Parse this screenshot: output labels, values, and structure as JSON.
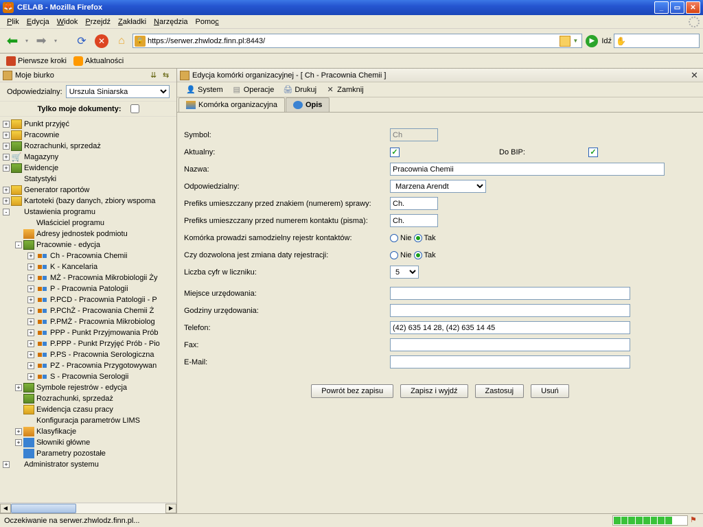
{
  "titlebar": {
    "title": "CELAB - Mozilla Firefox"
  },
  "menubar": [
    "Plik",
    "Edycja",
    "Widok",
    "Przejdź",
    "Zakładki",
    "Narzędzia",
    "Pomoc"
  ],
  "url": "https://serwer.zhwlodz.finn.pl:8443/",
  "go_label": "Idź",
  "bookmarks": [
    {
      "label": "Pierwsze kroki"
    },
    {
      "label": "Aktualności"
    }
  ],
  "left": {
    "title": "Moje biurko",
    "odpowiedzialny_label": "Odpowiedzialny:",
    "odpowiedzialny_value": "Urszula Siniarska",
    "tylko_label": "Tylko moje dokumenty:"
  },
  "tree": [
    {
      "lvl": 0,
      "tog": "+",
      "ic": "ic-a",
      "label": "Punkt przyjęć"
    },
    {
      "lvl": 0,
      "tog": "+",
      "ic": "ic-a",
      "label": "Pracownie"
    },
    {
      "lvl": 0,
      "tog": "+",
      "ic": "ic-b",
      "label": "Rozrachunki, sprzedaż"
    },
    {
      "lvl": 0,
      "tog": "+",
      "ic": "ic-c",
      "label": "Magazyny",
      "noic": true
    },
    {
      "lvl": 0,
      "tog": "+",
      "ic": "ic-b",
      "label": "Ewidencje"
    },
    {
      "lvl": 0,
      "tog": "",
      "ic": "ic-d",
      "label": "Statystyki",
      "notog": true
    },
    {
      "lvl": 0,
      "tog": "+",
      "ic": "ic-a",
      "label": "Generator raportów"
    },
    {
      "lvl": 0,
      "tog": "+",
      "ic": "ic-a",
      "label": "Kartoteki (bazy danych, zbiory wspoma"
    },
    {
      "lvl": 0,
      "tog": "-",
      "ic": "ic-e",
      "label": "Ustawienia programu"
    },
    {
      "lvl": 1,
      "tog": "",
      "ic": "ic-f",
      "label": "Właściciel programu",
      "notog": true
    },
    {
      "lvl": 1,
      "tog": "",
      "ic": "ic-h",
      "label": "Adresy jednostek podmiotu",
      "notog": true
    },
    {
      "lvl": 1,
      "tog": "-",
      "ic": "ic-b",
      "label": "Pracownie - edycja"
    },
    {
      "lvl": 2,
      "tog": "+",
      "ic": "ic-sm",
      "label": "Ch - Pracownia Chemii"
    },
    {
      "lvl": 2,
      "tog": "+",
      "ic": "ic-sm",
      "label": "K - Kancelaria"
    },
    {
      "lvl": 2,
      "tog": "+",
      "ic": "ic-sm",
      "label": "MŻ - Pracownia Mikrobiologii Ży"
    },
    {
      "lvl": 2,
      "tog": "+",
      "ic": "ic-sm",
      "label": "P - Pracownia Patologii"
    },
    {
      "lvl": 2,
      "tog": "+",
      "ic": "ic-sm",
      "label": "P.PCD - Pracownia Patologii - P"
    },
    {
      "lvl": 2,
      "tog": "+",
      "ic": "ic-sm",
      "label": "P.PChŻ - Pracowania Chemii Ż"
    },
    {
      "lvl": 2,
      "tog": "+",
      "ic": "ic-sm",
      "label": "P.PMŻ - Pracownia Mikrobiolog"
    },
    {
      "lvl": 2,
      "tog": "+",
      "ic": "ic-sm",
      "label": "PPP - Punkt Przyjmowania Prób"
    },
    {
      "lvl": 2,
      "tog": "+",
      "ic": "ic-sm",
      "label": "P.PPP - Punkt Przyjęć Prób - Pio"
    },
    {
      "lvl": 2,
      "tog": "+",
      "ic": "ic-sm",
      "label": "P.PS - Pracownia Serologiczna"
    },
    {
      "lvl": 2,
      "tog": "+",
      "ic": "ic-sm",
      "label": "PZ - Pracownia Przygotowywan"
    },
    {
      "lvl": 2,
      "tog": "+",
      "ic": "ic-sm",
      "label": "S - Pracownia Serologii"
    },
    {
      "lvl": 1,
      "tog": "+",
      "ic": "ic-b",
      "label": "Symbole rejestrów - edycja"
    },
    {
      "lvl": 1,
      "tog": "",
      "ic": "ic-b",
      "label": "Rozrachunki, sprzedaż",
      "notog": true
    },
    {
      "lvl": 1,
      "tog": "",
      "ic": "ic-a",
      "label": "Ewidencja czasu pracy",
      "notog": true
    },
    {
      "lvl": 1,
      "tog": "",
      "ic": "ic-e",
      "label": "Konfiguracja parametrów LIMS",
      "notog": true
    },
    {
      "lvl": 1,
      "tog": "+",
      "ic": "ic-h",
      "label": "Klasyfikacje"
    },
    {
      "lvl": 1,
      "tog": "+",
      "ic": "ic-g",
      "label": "Słowniki główne"
    },
    {
      "lvl": 1,
      "tog": "",
      "ic": "ic-g",
      "label": "Parametry pozostałe",
      "notog": true
    },
    {
      "lvl": 0,
      "tog": "+",
      "ic": "ic-e",
      "label": "Administrator systemu"
    }
  ],
  "right": {
    "title": "Edycja komórki organizacyjnej - [ Ch - Pracownia Chemii ]",
    "toolbar": [
      "System",
      "Operacje",
      "Drukuj",
      "Zamknij"
    ],
    "tabs": [
      "Komórka organizacyjna",
      "Opis"
    ],
    "active_tab": 1
  },
  "form": {
    "symbol_l": "Symbol:",
    "symbol_v": "Ch",
    "aktualny_l": "Aktualny:",
    "dobip_l": "Do BIP:",
    "nazwa_l": "Nazwa:",
    "nazwa_v": "Pracownia Chemii",
    "odp_l": "Odpowiedzialny:",
    "odp_v": "Marzena Arendt",
    "prefix1_l": "Prefiks umieszczany przed znakiem (numerem) sprawy:",
    "prefix1_v": "Ch.",
    "prefix2_l": "Prefiks umieszczany przed numerem kontaktu (pisma):",
    "prefix2_v": "Ch.",
    "rejestr_l": "Komórka prowadzi samodzielny rejestr kontaktów:",
    "zmiana_l": "Czy dozwolona jest zmiana daty rejestracji:",
    "liczba_l": "Liczba cyfr w liczniku:",
    "liczba_v": "5",
    "miejsce_l": "Miejsce urzędowania:",
    "godziny_l": "Godziny urzędowania:",
    "telefon_l": "Telefon:",
    "telefon_v": "(42) 635 14 28, (42) 635 14 45",
    "fax_l": "Fax:",
    "email_l": "E-Mail:",
    "nie": "Nie",
    "tak": "Tak"
  },
  "buttons": [
    "Powrót bez zapisu",
    "Zapisz i wyjdź",
    "Zastosuj",
    "Usuń"
  ],
  "status": "Oczekiwanie na serwer.zhwlodz.finn.pl..."
}
